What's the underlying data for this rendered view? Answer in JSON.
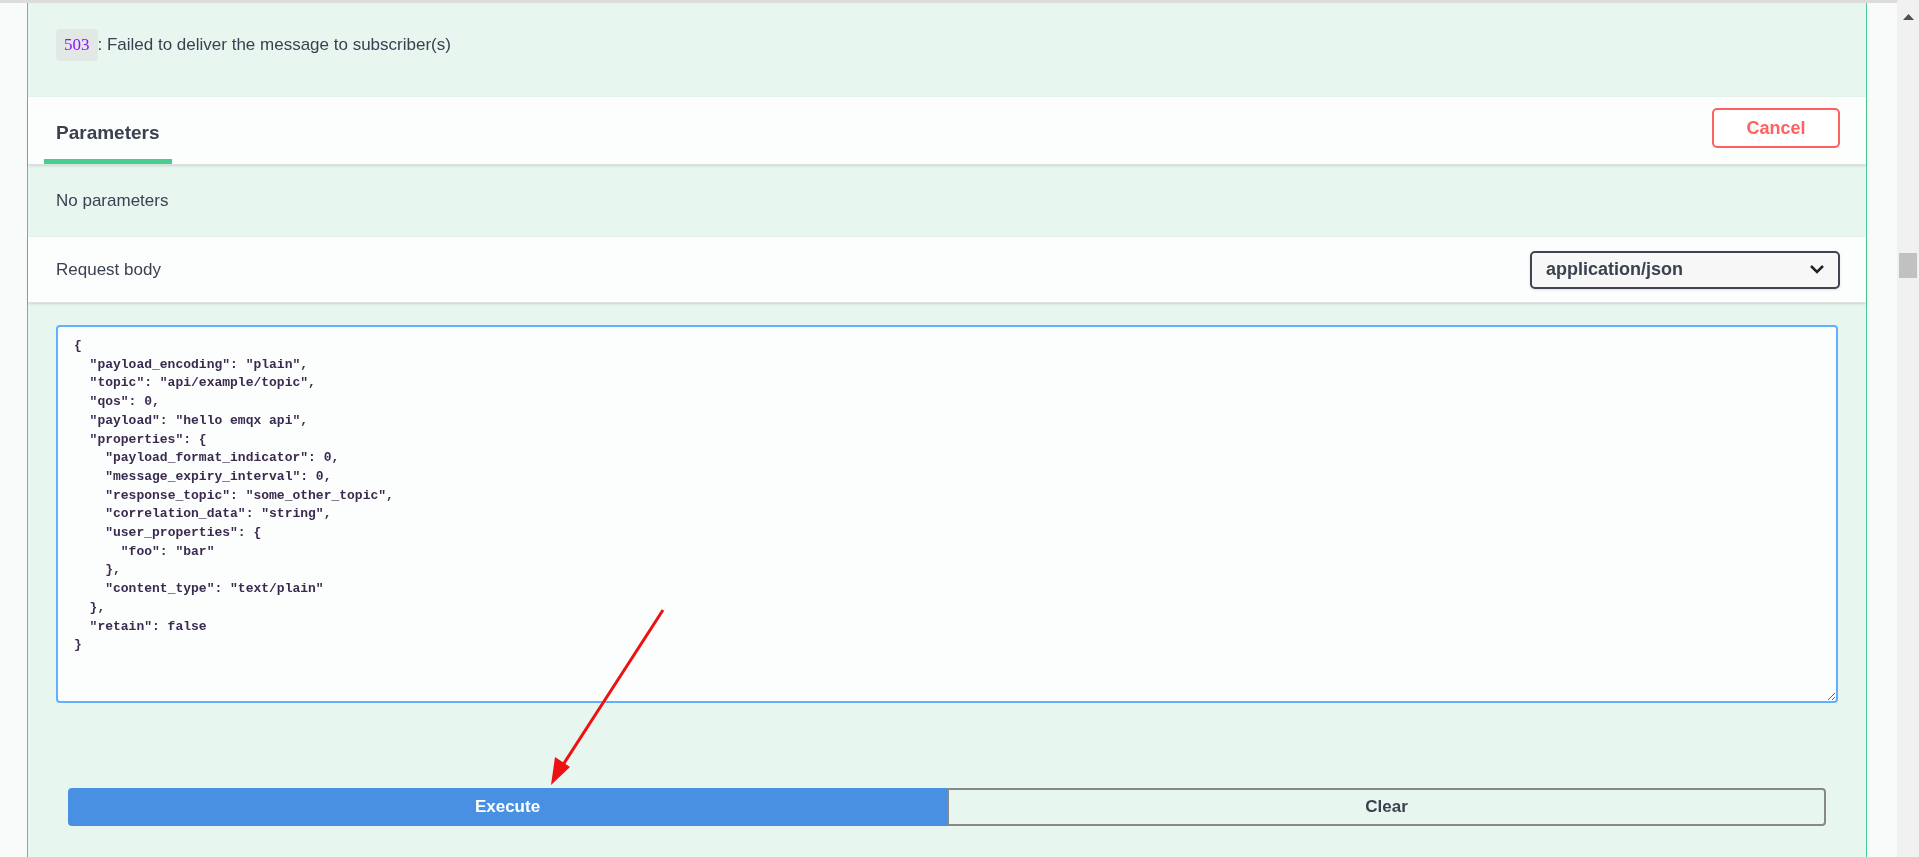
{
  "response_item": {
    "code": "503",
    "description": ": Failed to deliver the message to subscriber(s)"
  },
  "tabs": [
    {
      "label": "Parameters",
      "selected": true
    }
  ],
  "cancel_button": "Cancel",
  "parameters_message": "No parameters",
  "request_body": {
    "label": "Request body",
    "content_type": "application/json",
    "value": "{\n  \"payload_encoding\": \"plain\",\n  \"topic\": \"api/example/topic\",\n  \"qos\": 0,\n  \"payload\": \"hello emqx api\",\n  \"properties\": {\n    \"payload_format_indicator\": 0,\n    \"message_expiry_interval\": 0,\n    \"response_topic\": \"some_other_topic\",\n    \"correlation_data\": \"string\",\n    \"user_properties\": {\n      \"foo\": \"bar\"\n    },\n    \"content_type\": \"text/plain\"\n  },\n  \"retain\": false\n}"
  },
  "buttons": [
    {
      "label": "Execute",
      "kind": "primary"
    },
    {
      "label": "Clear",
      "kind": "secondary"
    }
  ]
}
